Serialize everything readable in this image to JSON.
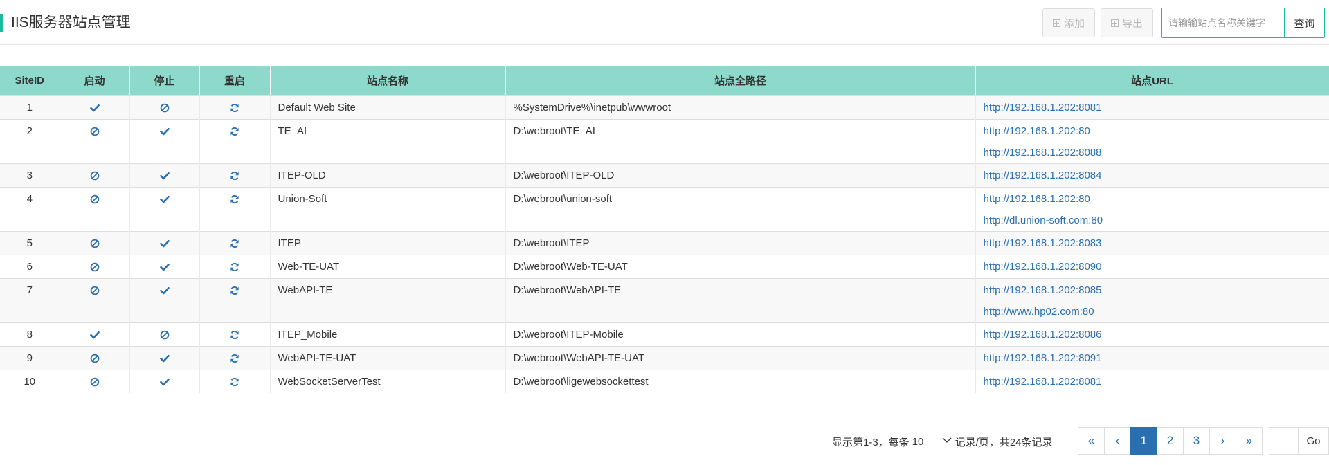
{
  "header": {
    "title": "IIS服务器站点管理",
    "add_label": "添加",
    "export_label": "导出",
    "search_placeholder": "请输输站点名称关键字",
    "search_button": "查询"
  },
  "table": {
    "columns": [
      "SiteID",
      "启动",
      "停止",
      "重启",
      "站点名称",
      "站点全路径",
      "站点URL"
    ],
    "rows": [
      {
        "id": "1",
        "start": "check-icon",
        "stop": "ban-icon",
        "name": "Default Web Site",
        "path": "%SystemDrive%\\inetpub\\wwwroot",
        "urls": [
          "http://192.168.1.202:8081"
        ]
      },
      {
        "id": "2",
        "start": "ban-icon",
        "stop": "check-icon",
        "name": "TE_AI",
        "path": "D:\\webroot\\TE_AI",
        "urls": [
          "http://192.168.1.202:80",
          "http://192.168.1.202:8088"
        ]
      },
      {
        "id": "3",
        "start": "ban-icon",
        "stop": "check-icon",
        "name": "ITEP-OLD",
        "path": "D:\\webroot\\ITEP-OLD",
        "urls": [
          "http://192.168.1.202:8084"
        ]
      },
      {
        "id": "4",
        "start": "ban-icon",
        "stop": "check-icon",
        "name": "Union-Soft",
        "path": "D:\\webroot\\union-soft",
        "urls": [
          "http://192.168.1.202:80",
          "http://dl.union-soft.com:80"
        ]
      },
      {
        "id": "5",
        "start": "ban-icon",
        "stop": "check-icon",
        "name": "ITEP",
        "path": "D:\\webroot\\ITEP",
        "urls": [
          "http://192.168.1.202:8083"
        ]
      },
      {
        "id": "6",
        "start": "ban-icon",
        "stop": "check-icon",
        "name": "Web-TE-UAT",
        "path": "D:\\webroot\\Web-TE-UAT",
        "urls": [
          "http://192.168.1.202:8090"
        ]
      },
      {
        "id": "7",
        "start": "ban-icon",
        "stop": "check-icon",
        "name": "WebAPI-TE",
        "path": "D:\\webroot\\WebAPI-TE",
        "urls": [
          "http://192.168.1.202:8085",
          "http://www.hp02.com:80"
        ]
      },
      {
        "id": "8",
        "start": "check-icon",
        "stop": "ban-icon",
        "name": "ITEP_Mobile",
        "path": "D:\\webroot\\ITEP-Mobile",
        "urls": [
          "http://192.168.1.202:8086"
        ]
      },
      {
        "id": "9",
        "start": "ban-icon",
        "stop": "check-icon",
        "name": "WebAPI-TE-UAT",
        "path": "D:\\webroot\\WebAPI-TE-UAT",
        "urls": [
          "http://192.168.1.202:8091"
        ]
      },
      {
        "id": "10",
        "start": "ban-icon",
        "stop": "check-icon",
        "name": "WebSocketServerTest",
        "path": "D:\\webroot\\ligewebsockettest",
        "urls": [
          "http://192.168.1.202:8081"
        ]
      }
    ]
  },
  "pagination": {
    "info_prefix": "显示第1-3，每条",
    "page_size": "10",
    "info_suffix": "记录/页，共24条记录",
    "first": "«",
    "prev": "‹",
    "pages": [
      "1",
      "2",
      "3"
    ],
    "active_page": "1",
    "next": "›",
    "last": "»",
    "go_label": "Go"
  },
  "colors": {
    "accent": "#1abc9c",
    "header_bg": "#8dd9cb",
    "link": "#2a6fb0"
  }
}
